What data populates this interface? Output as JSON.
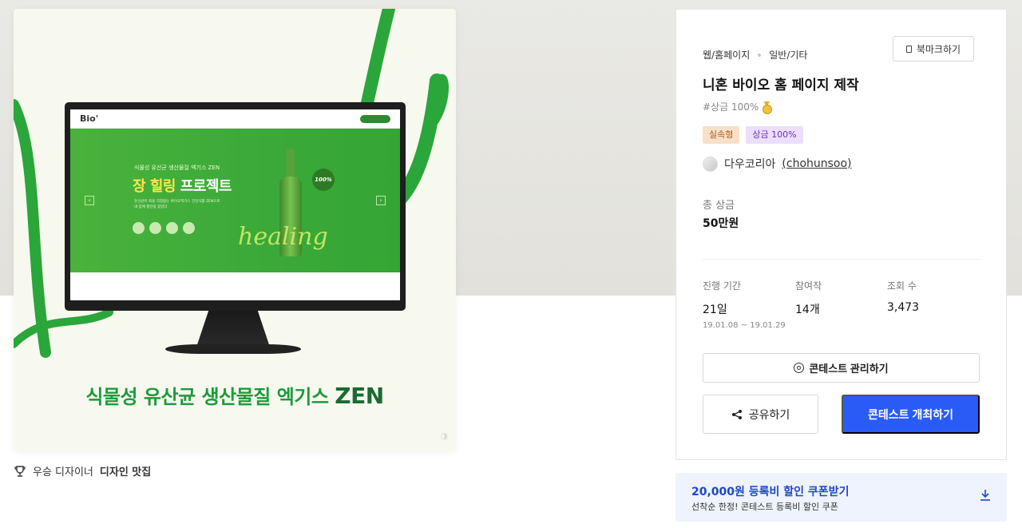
{
  "hero": {
    "banner_subtitle": "식물성 유산균 생산물질 엑기스 ZEN",
    "banner_title_a": "장 힐링",
    "banner_title_b": " 프로젝트",
    "banner_desc": "유산균이 죽을 걱정없는 바이오엑기스 건강식품 ZEN으로 내 몸에 평안을 찾았다",
    "badge_text": "100%",
    "script_word": "healing",
    "caption_main": "식물성 유산균 생산물질 엑기스 ",
    "caption_brand": "ZEN",
    "site_logo": "Bio'"
  },
  "award": {
    "prefix": "우승 디자이너",
    "name": "디자인 맛집"
  },
  "panel": {
    "category_main": "웹/홈페이지",
    "category_sub": "일반/기타",
    "bookmark_label": "북마크하기",
    "title": "니혼 바이오 홈 페이지 제작",
    "tagline": "#상금 100%",
    "badges": [
      "실속형",
      "상금 100%"
    ],
    "host_name": "다우코리아",
    "host_id": "(chohunsoo)",
    "prize_label": "총 상금",
    "prize_value": "50만원",
    "stats": [
      {
        "label": "진행 기간",
        "value": "21일",
        "range": "19.01.08 ~ 19.01.29"
      },
      {
        "label": "참여작",
        "value": "14개"
      },
      {
        "label": "조회 수",
        "value": "3,473"
      }
    ],
    "manage_label": "콘테스트 관리하기",
    "share_label": "공유하기",
    "host_button_label": "콘테스트 개최하기"
  },
  "coupon": {
    "title": "20,000원 등록비 할인 쿠폰받기",
    "subtitle": "선착순 한정! 콘테스트 등록비 할인 쿠폰"
  },
  "colors": {
    "accent": "#2a5bf6",
    "brand_green": "#1d9a3c",
    "coupon_bg": "#eef3fd"
  }
}
